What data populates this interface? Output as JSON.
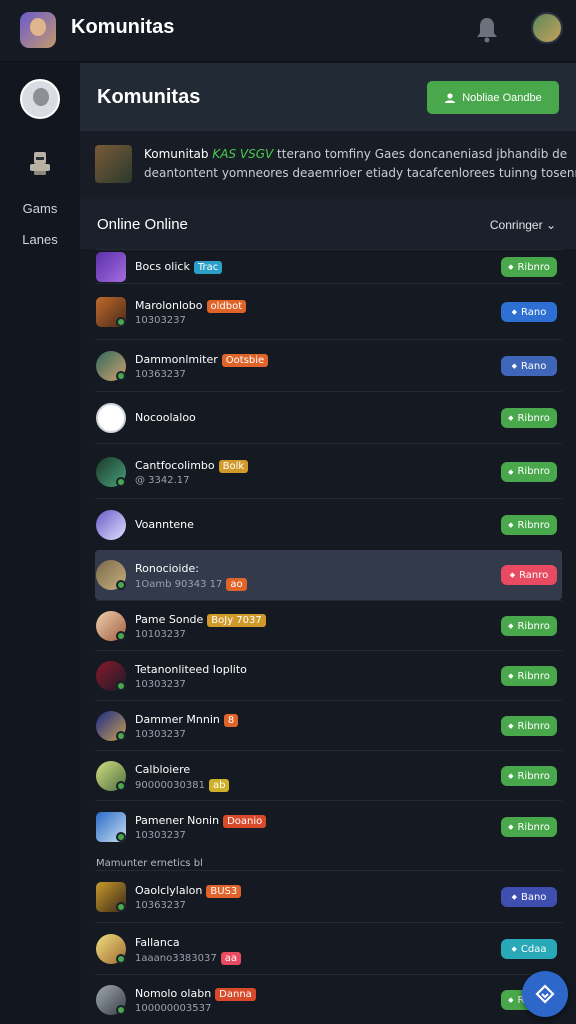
{
  "app": {
    "title": "Komunitas"
  },
  "sidebar": {
    "items": [
      {
        "label": "Gams"
      },
      {
        "label": "Lanes"
      }
    ]
  },
  "header": {
    "title": "Komunitas",
    "cta_label": "Nobliae Oandbe"
  },
  "description": {
    "name": "Komunitab",
    "tag": "KAS VSGV",
    "line1": "tterano tomfiny Gaes doncaneniasd jbhandib de",
    "line2": "deantontent yomneores deaemrioer etiady tacafcenlorees tuinng tosenrs"
  },
  "list": {
    "title": "Online  Online",
    "sort_label": "Conringer"
  },
  "section_label": "Mamunter ernetics bl",
  "colors": {
    "green": "#49a84b",
    "blue": "#2e6fd3",
    "red": "#e84a62",
    "teal": "#29a9b8",
    "indigo": "#3f4fb0"
  },
  "rows": [
    {
      "name": "Bocs olick",
      "sub": "",
      "badge": "",
      "badge_color": "",
      "tag": "Trac",
      "tag_color": "#2aa0c8",
      "action": "Ribnro",
      "action_color": "#49a84b"
    },
    {
      "name": "Marolonlobo",
      "sub": "10303237",
      "badge": "oldbot",
      "badge_color": "#e0632a",
      "tag": "",
      "tag_color": "",
      "action": "Rano",
      "action_color": "#2e6fd3"
    },
    {
      "name": "Dammonlmiter",
      "sub": "10363237",
      "badge": "Ootsbie",
      "badge_color": "#e0632a",
      "tag": "",
      "tag_color": "",
      "action": "Rano",
      "action_color": "#3f66b8"
    },
    {
      "name": "Nocoolaloo",
      "sub": "",
      "badge": "",
      "badge_color": "",
      "tag": "",
      "tag_color": "",
      "action": "Ribnro",
      "action_color": "#49a84b"
    },
    {
      "name": "Cantfocolimbo",
      "sub": "@ 3342.17",
      "badge": "Bolk",
      "badge_color": "#d09a2a",
      "tag": "",
      "tag_color": "",
      "action": "Ribnro",
      "action_color": "#49a84b"
    },
    {
      "name": "Voanntene",
      "sub": "",
      "badge": "",
      "badge_color": "",
      "tag": "",
      "tag_color": "",
      "action": "Ribnro",
      "action_color": "#49a84b"
    },
    {
      "name": "Ronocioide:",
      "sub": "1Oamb 90343 17",
      "badge": "",
      "badge_color": "",
      "tag": "ao",
      "tag_color": "#e0632a",
      "action": "Ranro",
      "action_color": "#e84a62"
    },
    {
      "name": "Pame Sonde",
      "sub": "10103237",
      "badge": "BoJy 7037",
      "badge_color": "#d09a2a",
      "tag": "",
      "tag_color": "",
      "action": "Ribnro",
      "action_color": "#49a84b"
    },
    {
      "name": "Tetanonliteed Ioplito",
      "sub": "10303237",
      "badge": "",
      "badge_color": "",
      "tag": "",
      "tag_color": "",
      "action": "Ribnro",
      "action_color": "#49a84b"
    },
    {
      "name": "Dammer Mnnin",
      "sub": "10303237",
      "badge": "8",
      "badge_color": "#e0632a",
      "tag": "",
      "tag_color": "",
      "action": "Ribnro",
      "action_color": "#49a84b"
    },
    {
      "name": "Calbloiere",
      "sub": "90000030381",
      "badge": "",
      "badge_color": "",
      "tag": "ab",
      "tag_color": "#d0b02a",
      "action": "Ribnro",
      "action_color": "#49a84b"
    },
    {
      "name": "Pamener Nonin",
      "sub": "10303237",
      "badge": "Doanio",
      "badge_color": "#d84a2a",
      "tag": "",
      "tag_color": "",
      "action": "Ribnro",
      "action_color": "#49a84b"
    },
    {
      "name": "Oaolclylalon",
      "sub": "10363237",
      "badge": "BUS3",
      "badge_color": "#e0632a",
      "tag": "",
      "tag_color": "",
      "action": "Bano",
      "action_color": "#3f4fb0"
    },
    {
      "name": "Fallanca",
      "sub": "1aaano3383037",
      "badge": "",
      "badge_color": "",
      "tag": "aa",
      "tag_color": "#e84a62",
      "action": "Cdaa",
      "action_color": "#29a9b8"
    },
    {
      "name": "Nomolo olabn",
      "sub": "100000003537",
      "badge": "Danna",
      "badge_color": "#d84a2a",
      "tag": "",
      "tag_color": "",
      "action": "Ribnro",
      "action_color": "#49a84b"
    }
  ]
}
